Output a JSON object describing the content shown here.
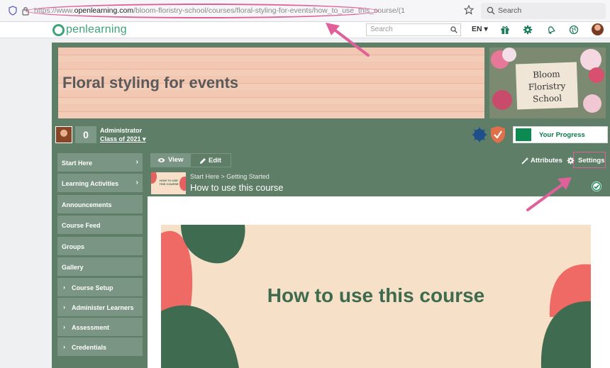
{
  "browser": {
    "url_prefix": "https://www.",
    "url_domain": "openlearning.com",
    "url_path": "/bloom-floristry-school/courses/floral-styling-for-events/how_to_use_this_course/",
    "url_tail": "(1",
    "search_label": "Search"
  },
  "site_header": {
    "logo_text": "penlearning",
    "search_placeholder": "Search",
    "language": "EN ▾"
  },
  "course": {
    "banner_title": "Floral styling for events",
    "school_name": "Bloom\nFloristry\nSchool",
    "admin_count": "0",
    "admin_role": "Administrator",
    "admin_class": "Class of 2021 ▾",
    "progress_label": "Your Progress"
  },
  "sidebar": {
    "items": [
      {
        "label": "Start Here",
        "chevron": "›"
      },
      {
        "label": "Learning Activities",
        "chevron": "›"
      },
      {
        "label": "Announcements"
      },
      {
        "label": "Course Feed"
      },
      {
        "label": "Groups"
      },
      {
        "label": "Gallery"
      },
      {
        "label": "Course Setup",
        "chevron": "›"
      },
      {
        "label": "Administer Learners",
        "chevron": "›"
      },
      {
        "label": "Assessment",
        "chevron": "›"
      },
      {
        "label": "Credentials",
        "chevron": "›"
      }
    ]
  },
  "main": {
    "tab_view": "View",
    "tab_edit": "Edit",
    "attributes_label": "Attributes",
    "settings_label": "Settings",
    "breadcrumb": "Start Here > Getting Started",
    "page_title": "How to use this course",
    "thumb_text": "HOW TO USE THIS COURSE",
    "hero_title": "How to use this course"
  },
  "colors": {
    "course_green": "#5e7e68",
    "sidebar_green": "#7a9583",
    "accent_pink": "#e0619a",
    "logo_green": "#3fa37a"
  }
}
